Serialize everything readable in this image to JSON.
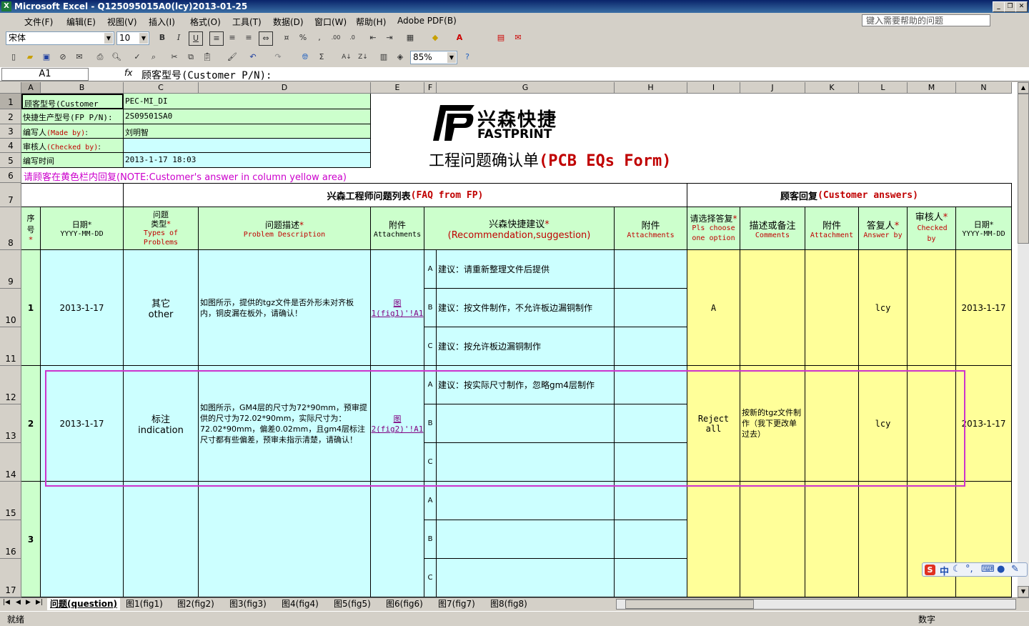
{
  "window": {
    "title": "Microsoft Excel - Q125095015A0(lcy)2013-01-25"
  },
  "menu": {
    "items": [
      "文件(F)",
      "编辑(E)",
      "视图(V)",
      "插入(I)",
      "格式(O)",
      "工具(T)",
      "数据(D)",
      "窗口(W)",
      "帮助(H)",
      "Adobe PDF(B)"
    ],
    "help_placeholder": "键入需要帮助的问题"
  },
  "toolbar": {
    "font": "宋体",
    "size": "10",
    "zoom": "85%"
  },
  "formula": {
    "cell_ref": "A1",
    "fx": "fx",
    "content": "顾客型号(Customer P/N):"
  },
  "columns": [
    "A",
    "B",
    "C",
    "D",
    "E",
    "F",
    "G",
    "H",
    "I",
    "J",
    "K",
    "L",
    "M",
    "N"
  ],
  "rows": [
    "1",
    "2",
    "3",
    "4",
    "5",
    "6",
    "7",
    "8",
    "9",
    "10",
    "11",
    "12",
    "13",
    "14",
    "15",
    "16",
    "17"
  ],
  "header_info": {
    "r1_label": "顾客型号(Customer P/N):",
    "r1_value": "PEC-MI_DI",
    "r2_label": "快捷生产型号(FP P/N):",
    "r2_value": "2S09501SA0",
    "r3_label": "编写人",
    "r3_en": "(Made by)",
    "r3_colon": ":",
    "r3_value": "刘明智",
    "r4_label": "审核人",
    "r4_en": "(Checked by)",
    "r4_colon": ":",
    "r5_label": "编写时间",
    "r5_value": "2013-1-17 18:03",
    "r6_note": "请顾客在黄色栏内回复(NOTE:Customer's answer in column yellow area)"
  },
  "logo": {
    "cn": "兴森快捷",
    "en": "FASTPRINT"
  },
  "form_title": {
    "cn": "工程问题确认单",
    "en": "(PCB EQs Form)"
  },
  "section": {
    "left_cn": "兴森工程师问题列表",
    "left_en": "(FAQ from FP)",
    "right_cn": "顾客回复",
    "right_en": "(Customer answers)"
  },
  "col_headers": {
    "seq": [
      "序",
      "号",
      "*"
    ],
    "date_cn": "日期*",
    "date_en": "YYYY-MM-DD",
    "type_cn1": "问题",
    "type_cn2": "类型",
    "type_star": "*",
    "type_en": "Types of Problems",
    "desc_cn": "问题描述",
    "desc_star": "*",
    "desc_en": "Problem Description",
    "att_cn": "附件",
    "att_en": "Attachments",
    "rec_cn": "兴森快捷建议",
    "rec_star": "*",
    "rec_en": "(Recommendation,suggestion)",
    "att2_cn": "附件",
    "att2_en": "Attachments",
    "choose_cn": "请选择答复",
    "choose_star": "*",
    "choose_en": "Pls choose one option",
    "comm_cn": "描述或备注",
    "comm_en": "Comments",
    "att3_cn": "附件",
    "att3_en": "Attachment",
    "ans_cn": "答复人",
    "ans_star": "*",
    "ans_en": "Answer by",
    "chk_cn": "审核人",
    "chk_star": "*",
    "chk_en": "Checked by",
    "date2_cn": "日期*",
    "date2_en": "YYYY-MM-DD"
  },
  "issues": [
    {
      "seq": "1",
      "date": "2013-1-17",
      "type_cn": "其它",
      "type_en": "other",
      "desc": "如图所示，提供的tgz文件是否外形未对齐板内，铜皮漏在板外，请确认！",
      "att": "图1(fig1)'!A1",
      "opts": [
        {
          "k": "A",
          "t": "建议：请重新整理文件后提供"
        },
        {
          "k": "B",
          "t": "建议：按文件制作，不允许板边漏铜制作"
        },
        {
          "k": "C",
          "t": "建议：按允许板边漏铜制作"
        }
      ],
      "choice": "A",
      "comment": "",
      "answer_by": "lcy",
      "date2": "2013-1-17"
    },
    {
      "seq": "2",
      "date": "2013-1-17",
      "type_cn": "标注",
      "type_en": "indication",
      "desc": "如图所示，GM4层的尺寸为72*90mm，预审提供的尺寸为72.02*90mm，实际尺寸为：72.02*90mm，偏差0.02mm，且gm4层标注尺寸都有些偏差，预审未指示清楚，请确认！",
      "att": "图2(fig2)'!A1",
      "opts": [
        {
          "k": "A",
          "t": "建议：按实际尺寸制作，忽略gm4层制作"
        },
        {
          "k": "B",
          "t": ""
        },
        {
          "k": "C",
          "t": ""
        }
      ],
      "choice": "Reject all",
      "comment": "按新的tgz文件制作（我下更改单过去）",
      "answer_by": "lcy",
      "date2": "2013-1-17"
    },
    {
      "seq": "3",
      "date": "",
      "type_cn": "",
      "type_en": "",
      "desc": "",
      "att": "",
      "opts": [
        {
          "k": "A",
          "t": ""
        },
        {
          "k": "B",
          "t": ""
        },
        {
          "k": "C",
          "t": ""
        }
      ],
      "choice": "",
      "comment": "",
      "answer_by": "",
      "date2": ""
    }
  ],
  "sheet_tabs": [
    "问题(question)",
    "图1(fig1)",
    "图2(fig2)",
    "图3(fig3)",
    "图4(fig4)",
    "图5(fig5)",
    "图6(fig6)",
    "图7(fig7)",
    "图8(fig8)"
  ],
  "status": {
    "left": "就绪",
    "right": "数字"
  },
  "ime": {
    "label": "中"
  }
}
